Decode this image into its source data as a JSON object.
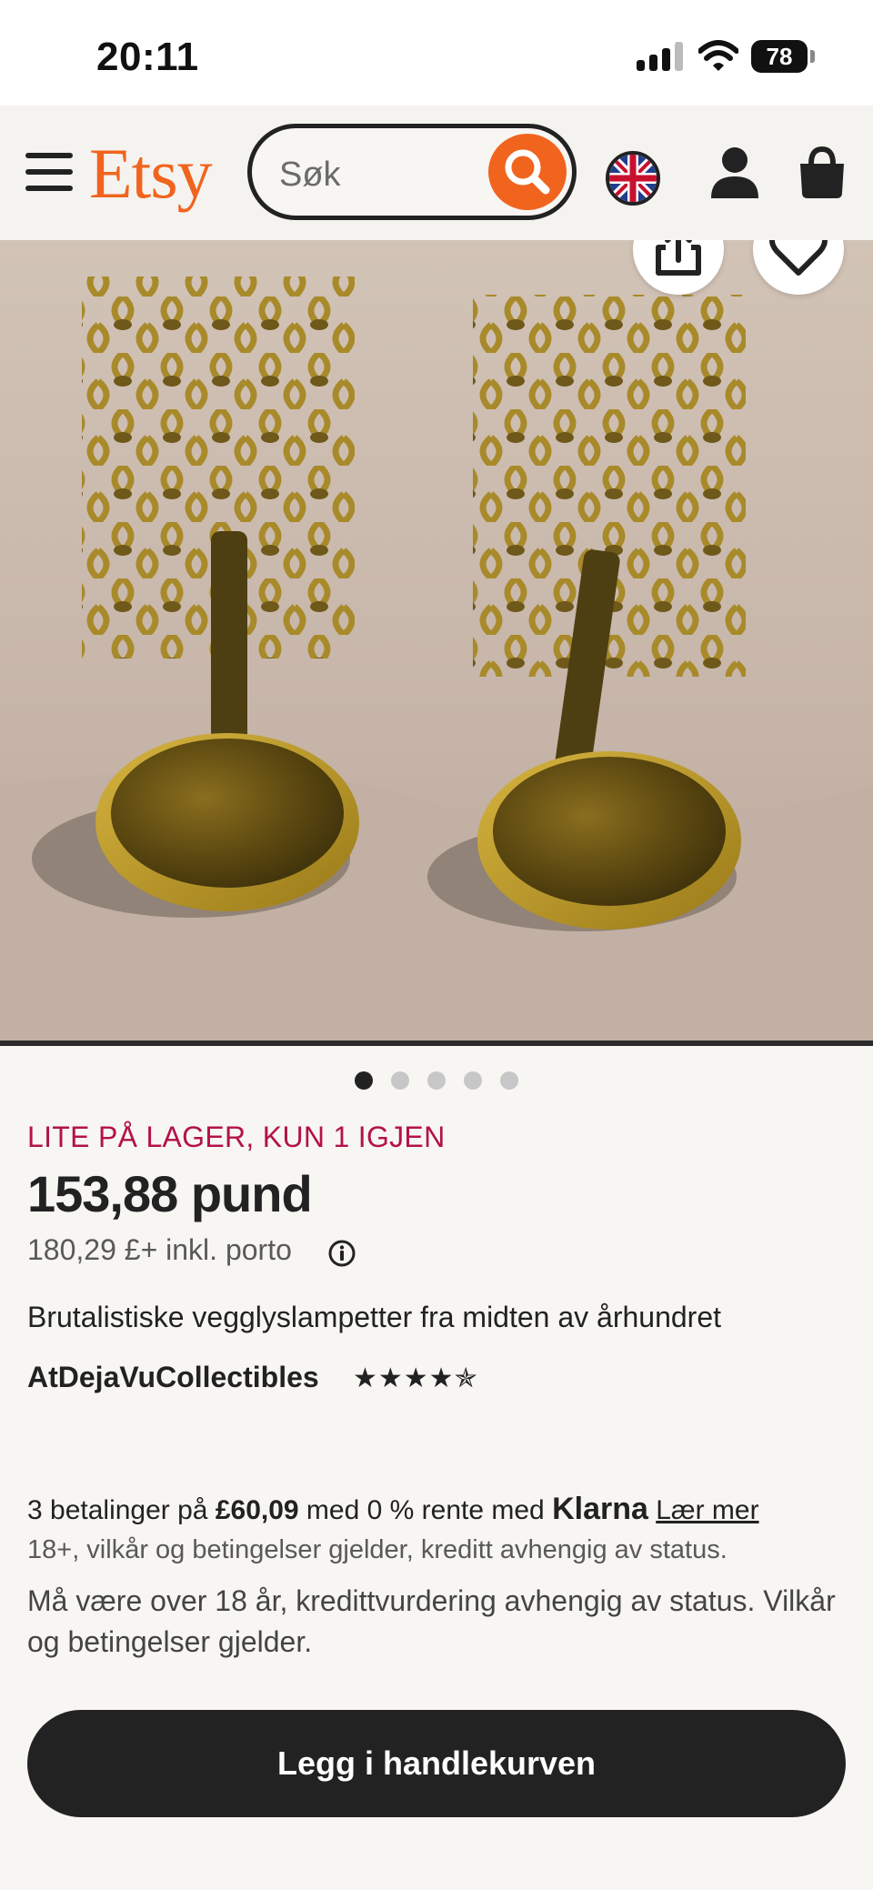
{
  "status_bar": {
    "time": "20:11",
    "battery": "78"
  },
  "header": {
    "logo": "Etsy",
    "search_placeholder": "Søk"
  },
  "carousel": {
    "total_images": 5,
    "active_index": 0
  },
  "product": {
    "stock_notice": "LITE PÅ LAGER, KUN 1 IGJEN",
    "price": "153,88 pund",
    "shipping_price": "180,29 £+ inkl. porto",
    "title": "Brutalistiske vegglyslampetter fra midten av århundret",
    "shop_name": "AtDejaVuCollectibles",
    "rating": 4.5,
    "rating_stars": "★★★★✯"
  },
  "klarna": {
    "prefix": "3 betalinger på ",
    "amount": "£60,09",
    "middle": " med 0 % rente med ",
    "brand": "Klarna",
    "link": "Lær mer",
    "terms_short": "18+, vilkår og betingelser gjelder, kreditt avhengig av status.",
    "terms_long": "Må være over 18 år, kredittvurdering avhengig av status. Vilkår og betingelser gjelder."
  },
  "actions": {
    "add_to_cart": "Legg i handlekurven"
  },
  "colors": {
    "brand": "#f1641e",
    "stock": "#b3124a",
    "button": "#222222"
  }
}
